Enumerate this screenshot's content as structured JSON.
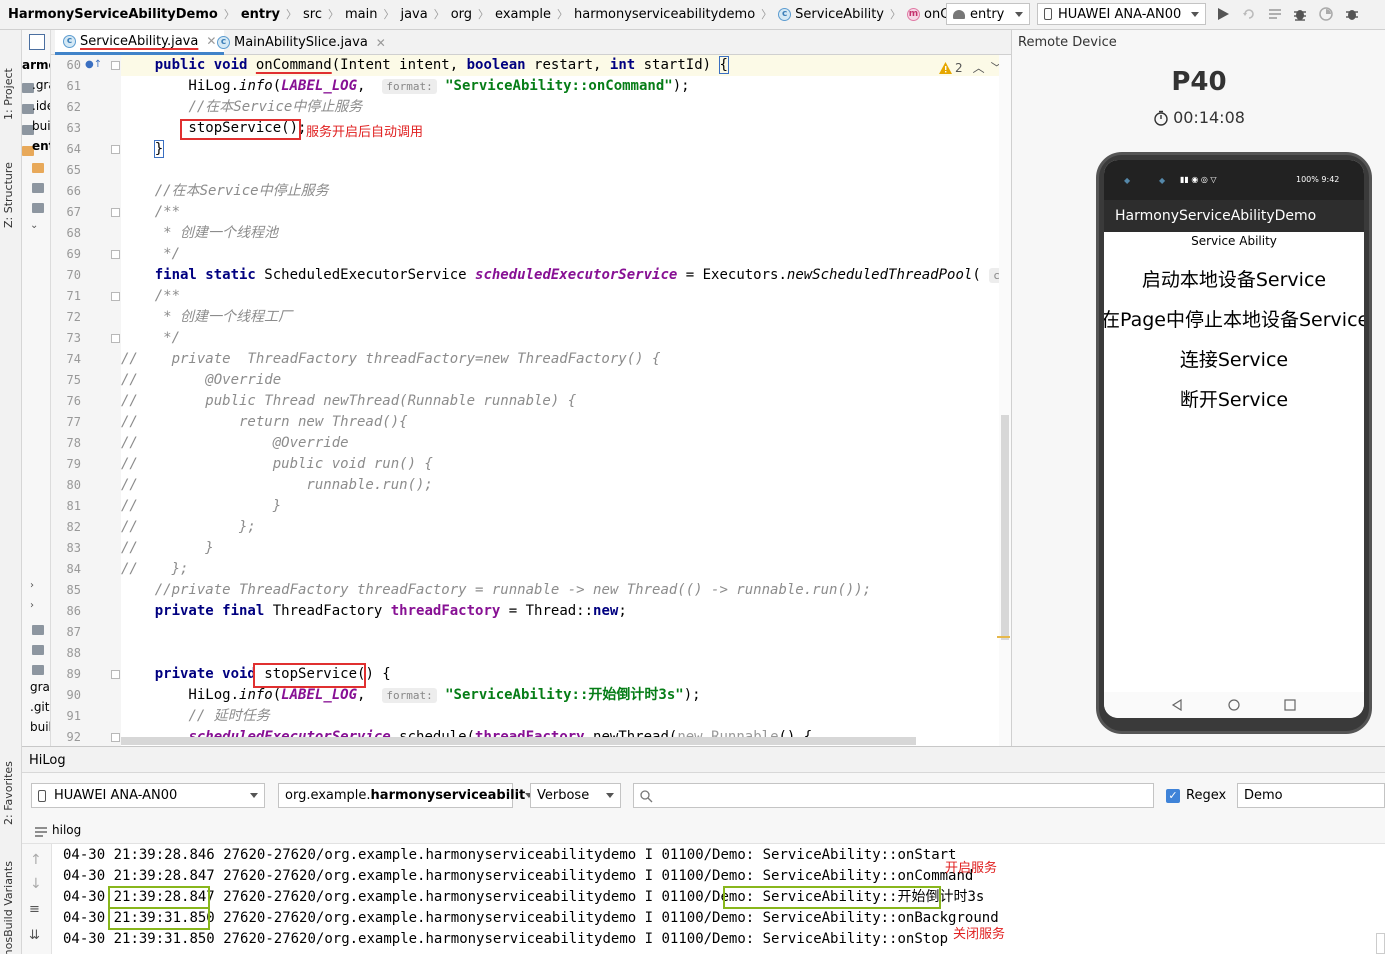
{
  "breadcrumb": [
    {
      "label": "HarmonyServiceAbilityDemo",
      "bold": true,
      "icon": ""
    },
    {
      "label": "entry",
      "bold": true,
      "icon": ""
    },
    {
      "label": "src",
      "bold": false,
      "icon": ""
    },
    {
      "label": "main",
      "bold": false,
      "icon": ""
    },
    {
      "label": "java",
      "bold": false,
      "icon": ""
    },
    {
      "label": "org",
      "bold": false,
      "icon": ""
    },
    {
      "label": "example",
      "bold": false,
      "icon": ""
    },
    {
      "label": "harmonyserviceabilitydemo",
      "bold": false,
      "icon": ""
    },
    {
      "label": "ServiceAbility",
      "bold": false,
      "icon": "c"
    },
    {
      "label": "onCommand",
      "bold": false,
      "icon": "m"
    }
  ],
  "toolbar": {
    "run_config": "entry",
    "device": "HUAWEI ANA-AN00"
  },
  "left_stripe": {
    "project": "1: Project",
    "structure": "Z: Structure",
    "favorites": "2: Favorites",
    "build_variants": "OhosBuild Variants"
  },
  "project_tree": [
    {
      "label": "armo",
      "bold": true
    },
    {
      "label": ".gra",
      "bold": false
    },
    {
      "label": ".ide",
      "bold": false
    },
    {
      "label": "buil",
      "bold": false
    },
    {
      "label": "ent",
      "bold": true
    },
    {
      "label": "gra",
      "bold": false
    },
    {
      "label": ".giti",
      "bold": false
    },
    {
      "label": "buil",
      "bold": false
    }
  ],
  "editor_tabs": [
    {
      "label": "ServiceAbility.java",
      "active": true
    },
    {
      "label": "MainAbilitySlice.java",
      "active": false
    }
  ],
  "editor": {
    "warnings": "2",
    "line_numbers": [
      "60",
      "61",
      "62",
      "63",
      "64",
      "65",
      "66",
      "67",
      "68",
      "69",
      "70",
      "71",
      "72",
      "73",
      "74",
      "75",
      "76",
      "77",
      "78",
      "79",
      "80",
      "81",
      "82",
      "83",
      "84",
      "85",
      "86",
      "87",
      "88",
      "89",
      "90",
      "91",
      "92"
    ],
    "annotation_auto_call": "服务开启后自动调用",
    "param_hint_format": "format:",
    "param_hint_core": "corePoolSiz"
  },
  "remote_device": {
    "panel_title": "Remote Device",
    "model": "P40",
    "timer": "00:14:08",
    "status_right": "100% 9:42",
    "app_title": "HarmonyServiceAbilityDemo",
    "page_label": "Service Ability",
    "buttons": [
      "启动本地设备Service",
      "在Page中停止本地设备Service",
      "连接Service",
      "断开Service"
    ]
  },
  "hilog": {
    "title": "HiLog",
    "device": "HUAWEI ANA-AN00",
    "package": "org.example.harmonyserviceabilit",
    "package_prefix": "org.example.",
    "package_bold": "harmonyserviceabilit",
    "level": "Verbose",
    "search_value": "",
    "regex_label": "Regex",
    "regex_checked": true,
    "filter_value": "Demo",
    "filter_name": "hilog",
    "annotation_start": "开启服务",
    "annotation_stop": "关闭服务",
    "lines": [
      {
        "date": "04-30",
        "time": "21:39:28.846",
        "rest": "27620-27620/org.example.harmonyserviceabilitydemo I 01100/Demo: ",
        "msg": "ServiceAbility::onStart"
      },
      {
        "date": "04-30",
        "time": "21:39:28.847",
        "rest": "27620-27620/org.example.harmonyserviceabilitydemo I 01100/Demo: ",
        "msg": "ServiceAbility::onCommand"
      },
      {
        "date": "04-30",
        "time": "21:39:28.847",
        "rest": "27620-27620/org.example.harmonyserviceabilitydemo I 01100/Demo: ",
        "msg": "ServiceAbility::开始倒计时3s"
      },
      {
        "date": "04-30",
        "time": "21:39:31.850",
        "rest": "27620-27620/org.example.harmonyserviceabilitydemo I 01100/Demo: ",
        "msg": "ServiceAbility::onBackground"
      },
      {
        "date": "04-30",
        "time": "21:39:31.850",
        "rest": "27620-27620/org.example.harmonyserviceabilitydemo I 01100/Demo: ",
        "msg": "ServiceAbility::onStop"
      }
    ]
  },
  "colors": {
    "annotation_red": "#e03030",
    "highlight_green": "#88b61c",
    "keyword": "#000080",
    "string": "#067d17",
    "field": "#871094",
    "comment": "#8c8c8c"
  }
}
